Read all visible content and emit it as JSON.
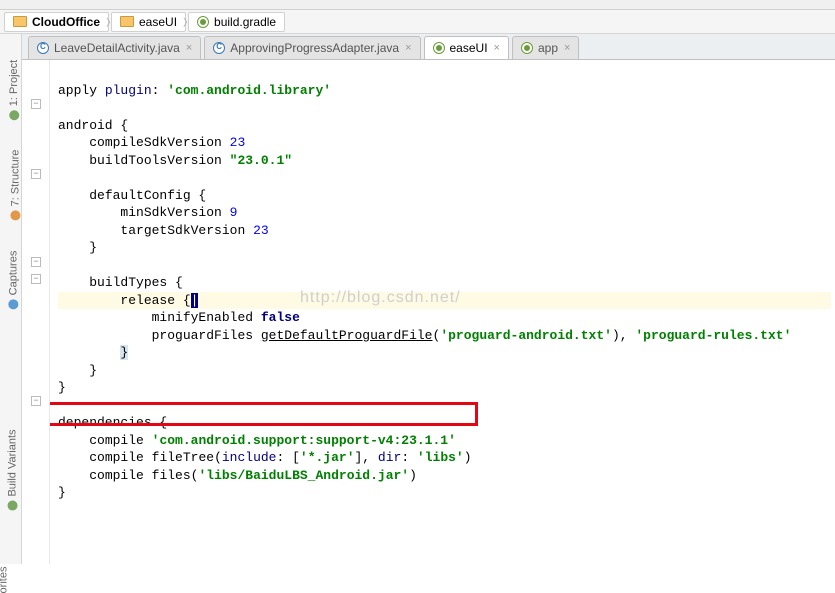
{
  "breadcrumbs": {
    "project": "CloudOffice",
    "module": "easeUI",
    "file": "build.gradle"
  },
  "tabs": [
    {
      "label": "LeaveDetailActivity.java",
      "type": "java",
      "active": false
    },
    {
      "label": "ApprovingProgressAdapter.java",
      "type": "java",
      "active": false
    },
    {
      "label": "easeUI",
      "type": "gradle",
      "active": true
    },
    {
      "label": "app",
      "type": "gradle",
      "active": false
    }
  ],
  "sidebar": {
    "project": "1: Project",
    "structure": "7: Structure",
    "captures": "Captures",
    "build_variants": "Build Variants",
    "orites": "orites"
  },
  "code": {
    "l1_apply": "apply",
    "l1_plugin": "plugin",
    "l1_str": "'com.android.library'",
    "l3_android": "android {",
    "l4_csv": "compileSdkVersion",
    "l4_num": "23",
    "l5_btv": "buildToolsVersion",
    "l5_str": "\"23.0.1\"",
    "l7_dc": "defaultConfig {",
    "l8_msv": "minSdkVersion",
    "l8_num": "9",
    "l9_tsv": "targetSdkVersion",
    "l9_num": "23",
    "l10_close": "}",
    "l12_bt": "buildTypes {",
    "l13_rel": "release {",
    "l14_me": "minifyEnabled",
    "l14_false": "false",
    "l15_pf": "proguardFiles",
    "l15_fn": "getDefaultProguardFile",
    "l15_arg1": "'proguard-android.txt'",
    "l15_arg2": "'proguard-rules.txt'",
    "l16_close": "}",
    "l17_close": "}",
    "l18_close": "}",
    "l20_dep": "dependencies {",
    "l21_compile": "compile",
    "l21_str": "'com.android.support:support-v4:23.1.1'",
    "l22_compile": "compile",
    "l22_ft": "fileTree",
    "l22_inc": "include",
    "l22_jar": "'*.jar'",
    "l22_dir": "dir",
    "l22_libs": "'libs'",
    "l23_compile": "compile",
    "l23_files": "files",
    "l23_arg": "'libs/BaiduLBS_Android.jar'",
    "l24_close": "}"
  },
  "watermark": "http://blog.csdn.net/"
}
